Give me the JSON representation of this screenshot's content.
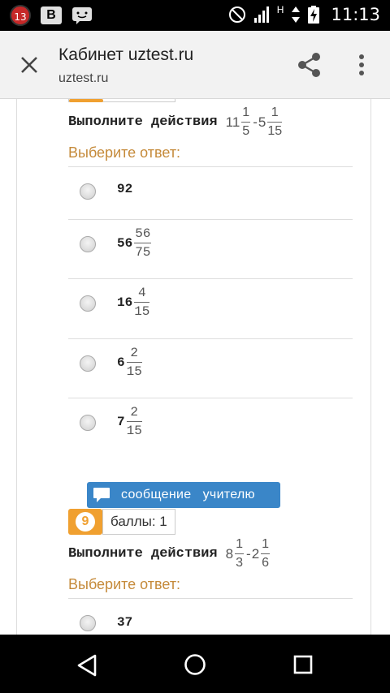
{
  "status_bar": {
    "notification_count": "13",
    "app_icon_letter": "B",
    "network_type": "H",
    "time": "11:13"
  },
  "appbar": {
    "title": "Кабинет uztest.ru",
    "subtitle": "uztest.ru"
  },
  "questions": [
    {
      "prompt": "Выполните действия",
      "expr": {
        "a_whole": "11",
        "a_num": "1",
        "a_den": "5",
        "op": "-",
        "b_whole": "5",
        "b_num": "1",
        "b_den": "15"
      },
      "choose_label": "Выберите ответ:",
      "answers": [
        {
          "whole": "92",
          "num": "",
          "den": ""
        },
        {
          "whole": "56",
          "num": "56",
          "den": "75"
        },
        {
          "whole": "16",
          "num": "4",
          "den": "15"
        },
        {
          "whole": "6",
          "num": "2",
          "den": "15"
        },
        {
          "whole": "7",
          "num": "2",
          "den": "15"
        }
      ]
    },
    {
      "number": "9",
      "points_label": "баллы: 1",
      "prompt": "Выполните действия",
      "expr": {
        "a_whole": "8",
        "a_num": "1",
        "a_den": "3",
        "op": "-",
        "b_whole": "2",
        "b_num": "1",
        "b_den": "6"
      },
      "choose_label": "Выберите ответ:",
      "answers": [
        {
          "whole": "37",
          "num": "",
          "den": ""
        }
      ]
    }
  ],
  "message_button": {
    "label": "сообщение   учителю"
  },
  "colors": {
    "accent_orange": "#f0a030",
    "choose_label": "#c58a3a",
    "message_button": "#3a86c8"
  },
  "icons": [
    "close-icon",
    "share-icon",
    "more-vert-icon",
    "radio-button-icon",
    "chat-bubble-icon",
    "nav-back-icon",
    "nav-home-icon",
    "nav-recents-icon"
  ]
}
